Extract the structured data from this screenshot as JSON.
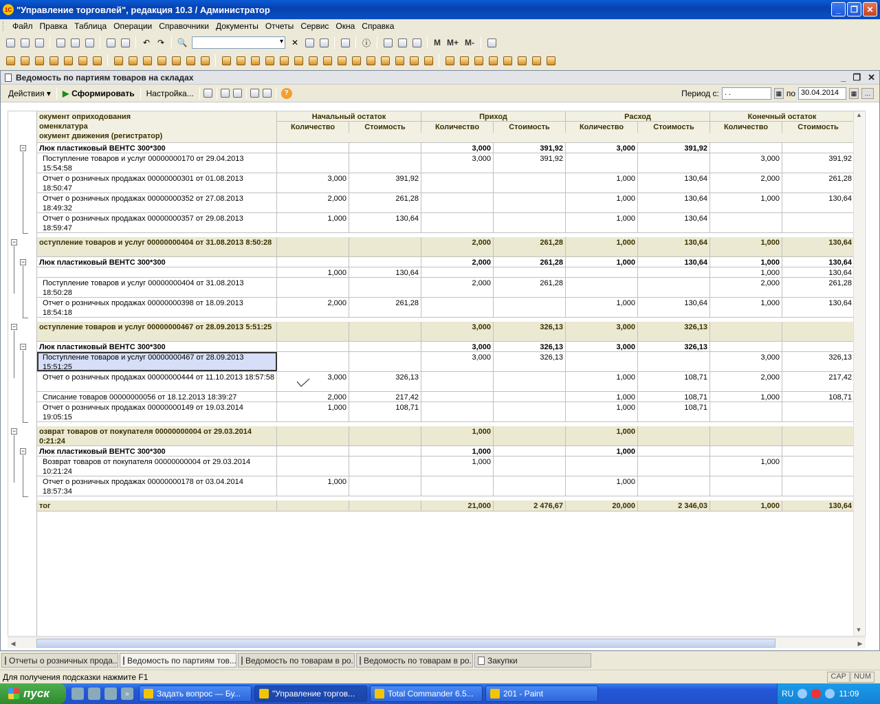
{
  "window": {
    "title": "\"Управление торговлей\", редакция 10.3 / Администратор",
    "app_icon": "1С"
  },
  "menu": [
    "Файл",
    "Правка",
    "Таблица",
    "Операции",
    "Справочники",
    "Документы",
    "Отчеты",
    "Сервис",
    "Окна",
    "Справка"
  ],
  "toolbar": {
    "m": "M",
    "mplus": "M+",
    "mminus": "M-"
  },
  "report_window": {
    "title": "Ведомость по партиям товаров на складах"
  },
  "actions": {
    "actions_label": "Действия",
    "run_label": "Сформировать",
    "settings_label": "Настройка...",
    "period_label": "Период с:",
    "period_from": ". .",
    "to_label": "по",
    "period_to": "30.04.2014"
  },
  "header": {
    "col0": [
      "окумент оприходования",
      "оменклатура",
      "окумент движения (регистратор)"
    ],
    "groups": [
      "Начальный остаток",
      "Приход",
      "Расход",
      "Конечный остаток"
    ],
    "sub": [
      "Количество",
      "Стоимость",
      "Количество",
      "Стоимость",
      "Количество",
      "Стоимость",
      "Количество",
      "Стоимость"
    ]
  },
  "rows": [
    {
      "t": "sub",
      "c": [
        "Люк пластиковый ВЕНТС 300*300",
        "",
        "",
        "3,000",
        "391,92",
        "3,000",
        "391,92",
        "",
        ""
      ]
    },
    {
      "t": "dtl",
      "c": [
        "Поступление товаров и услуг 00000000170 от 29.04.2013 15:54:58",
        "",
        "",
        "3,000",
        "391,92",
        "",
        "",
        "3,000",
        "391,92"
      ]
    },
    {
      "t": "dtl",
      "c": [
        "Отчет о розничных продажах 00000000301 от 01.08.2013 18:50:47",
        "3,000",
        "391,92",
        "",
        "",
        "1,000",
        "130,64",
        "2,000",
        "261,28"
      ]
    },
    {
      "t": "dtl",
      "c": [
        "Отчет о розничных продажах 00000000352 от 27.08.2013 18:49:32",
        "2,000",
        "261,28",
        "",
        "",
        "1,000",
        "130,64",
        "1,000",
        "130,64"
      ]
    },
    {
      "t": "dtl",
      "c": [
        "Отчет о розничных продажах 00000000357 от 29.08.2013 18:59:47",
        "1,000",
        "130,64",
        "",
        "",
        "1,000",
        "130,64",
        "",
        ""
      ]
    },
    {
      "t": "grp",
      "c": [
        "оступление товаров и услуг 00000000404 от 31.08.2013 8:50:28",
        "",
        "",
        "2,000",
        "261,28",
        "1,000",
        "130,64",
        "1,000",
        "130,64"
      ]
    },
    {
      "t": "sub",
      "c": [
        "Люк пластиковый ВЕНТС 300*300",
        "",
        "",
        "2,000",
        "261,28",
        "1,000",
        "130,64",
        "1,000",
        "130,64"
      ]
    },
    {
      "t": "dtl",
      "c": [
        "",
        "1,000",
        "130,64",
        "",
        "",
        "",
        "",
        "1,000",
        "130,64"
      ]
    },
    {
      "t": "dtl",
      "c": [
        "Поступление товаров и услуг 00000000404 от 31.08.2013 18:50:28",
        "",
        "",
        "2,000",
        "261,28",
        "",
        "",
        "2,000",
        "261,28"
      ]
    },
    {
      "t": "dtl",
      "c": [
        "Отчет о розничных продажах 00000000398 от 18.09.2013 18:54:18",
        "2,000",
        "261,28",
        "",
        "",
        "1,000",
        "130,64",
        "1,000",
        "130,64"
      ]
    },
    {
      "t": "grp",
      "c": [
        "оступление товаров и услуг 00000000467 от 28.09.2013 5:51:25",
        "",
        "",
        "3,000",
        "326,13",
        "3,000",
        "326,13",
        "",
        ""
      ]
    },
    {
      "t": "sub",
      "c": [
        "Люк пластиковый ВЕНТС 300*300",
        "",
        "",
        "3,000",
        "326,13",
        "3,000",
        "326,13",
        "",
        ""
      ]
    },
    {
      "t": "dtl",
      "sel": true,
      "c": [
        "Поступление товаров и услуг 00000000467 от 28.09.2013 15:51:25",
        "",
        "",
        "3,000",
        "326,13",
        "",
        "",
        "3,000",
        "326,13"
      ]
    },
    {
      "t": "dtl",
      "c": [
        "Отчет о розничных продажах 00000000444 от 11.10.2013 18:57:58",
        "3,000",
        "326,13",
        "",
        "",
        "1,000",
        "108,71",
        "2,000",
        "217,42"
      ]
    },
    {
      "t": "dtl",
      "c": [
        "Списание товаров 00000000056 от 18.12.2013 18:39:27",
        "2,000",
        "217,42",
        "",
        "",
        "1,000",
        "108,71",
        "1,000",
        "108,71"
      ]
    },
    {
      "t": "dtl",
      "c": [
        "Отчет о розничных продажах 00000000149 от 19.03.2014 19:05:15",
        "1,000",
        "108,71",
        "",
        "",
        "1,000",
        "108,71",
        "",
        ""
      ]
    },
    {
      "t": "grp",
      "c": [
        "озврат товаров от покупателя 00000000004 от 29.03.2014 0:21:24",
        "",
        "",
        "1,000",
        "",
        "1,000",
        "",
        "",
        ""
      ]
    },
    {
      "t": "sub",
      "c": [
        "Люк пластиковый ВЕНТС 300*300",
        "",
        "",
        "1,000",
        "",
        "1,000",
        "",
        "",
        ""
      ]
    },
    {
      "t": "dtl",
      "c": [
        "Возврат товаров от покупателя 00000000004 от 29.03.2014 10:21:24",
        "",
        "",
        "1,000",
        "",
        "",
        "",
        "1,000",
        ""
      ]
    },
    {
      "t": "dtl",
      "c": [
        "Отчет о розничных продажах 00000000178 от 03.04.2014 18:57:34",
        "1,000",
        "",
        "",
        "",
        "1,000",
        "",
        "",
        ""
      ]
    },
    {
      "t": "tot",
      "c": [
        "тог",
        "",
        "",
        "21,000",
        "2 476,67",
        "20,000",
        "2 346,03",
        "1,000",
        "130,64"
      ]
    }
  ],
  "tasktabs": [
    "Отчеты о розничных прода...",
    "Ведомость по партиям тов...",
    "Ведомость по товарам в ро...",
    "Ведомость по товарам в ро...",
    "Закупки"
  ],
  "status": {
    "hint": "Для получения подсказки нажмите F1",
    "cap": "CAP",
    "num": "NUM"
  },
  "taskbar": {
    "start": "пуск",
    "buttons": [
      "Задать вопрос — Бу...",
      "\"Управление торгов...",
      "Total Commander 6.5...",
      "201 - Paint"
    ],
    "lang": "RU",
    "clock": "11:09"
  }
}
